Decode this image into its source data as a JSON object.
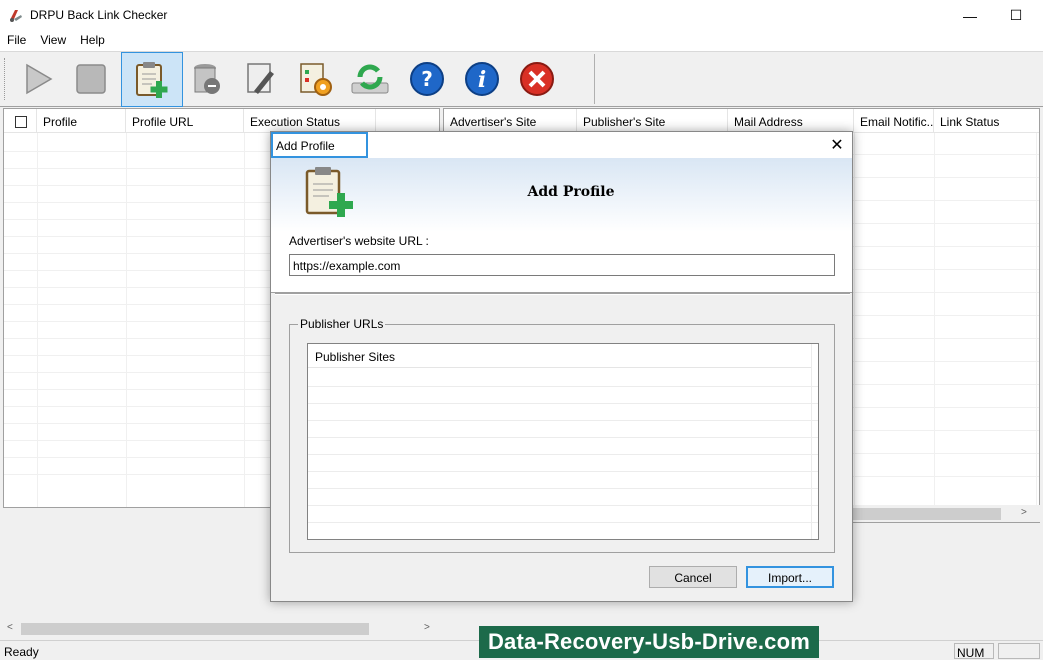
{
  "window": {
    "title": "DRPU Back Link Checker",
    "minimize_glyph": "—",
    "maximize_glyph": "☐"
  },
  "menu": {
    "items": [
      "File",
      "View",
      "Help"
    ]
  },
  "toolbar": {
    "buttons": [
      {
        "icon": "play-icon"
      },
      {
        "icon": "stop-icon"
      },
      {
        "icon": "add-profile-icon",
        "active": true
      },
      {
        "icon": "delete-profile-icon"
      },
      {
        "icon": "edit-profile-icon"
      },
      {
        "icon": "settings-icon"
      },
      {
        "icon": "refresh-icon"
      },
      {
        "icon": "help-icon"
      },
      {
        "icon": "info-icon"
      },
      {
        "icon": "exit-icon"
      }
    ]
  },
  "left_table": {
    "columns": [
      "Profile",
      "Profile URL",
      "Execution Status"
    ]
  },
  "right_table": {
    "columns": [
      "Advertiser's Site",
      "Publisher's Site",
      "Mail Address",
      "Email Notific...",
      "Link Status"
    ]
  },
  "scroll": {
    "left_arrow": "<",
    "right_arrow": ">"
  },
  "status": {
    "text": "Ready",
    "num": "NUM"
  },
  "watermark": "Data-Recovery-Usb-Drive.com",
  "dialog": {
    "title": "Add Profile",
    "close_glyph": "✕",
    "heading": "Add Profile",
    "url_label": "Advertiser's website URL :",
    "url_value": "https://example.com",
    "publisher_group": "Publisher URLs",
    "publisher_list_header": "Publisher Sites",
    "cancel_label": "Cancel",
    "import_label": "Import..."
  },
  "colors": {
    "accent": "#3393df",
    "watermark_bg": "#1c6a4a",
    "help_blue": "#1f67c8",
    "exit_red": "#d93025"
  }
}
